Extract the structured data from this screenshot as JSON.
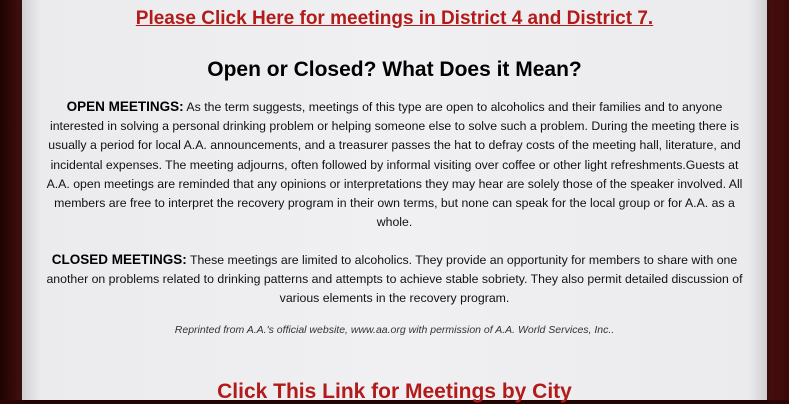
{
  "top_link": "Please Click Here for meetings in District 4 and District 7.",
  "heading": "Open or Closed? What Does it Mean?",
  "open_meetings": {
    "label": "OPEN MEETINGS:",
    "text": " As the term suggests, meetings of this type are open to alcoholics and their families and to anyone interested in solving a personal drinking problem or helping someone else to solve such a problem. During the meeting there is usually a period for local A.A. announcements, and a treasurer passes the hat to defray costs of the meeting hall, literature, and incidental expenses. The meeting adjourns, often followed by informal visiting over coffee or other light refreshments.Guests at A.A. open meetings are reminded that any opinions or interpretations they may hear are solely those of the speaker involved. All members are free to interpret the recovery program in their own terms, but none can speak for the local group or for A.A. as a whole."
  },
  "closed_meetings": {
    "label": "CLOSED MEETINGS:",
    "text": " These meetings are limited to alcoholics. They provide an opportunity for members to share with one another on problems related to drinking patterns and attempts to achieve stable sobriety. They also permit detailed discussion of various elements in the recovery program."
  },
  "credit": "Reprinted from A.A.'s official website, www.aa.org with permission of A.A. World Services, Inc..",
  "city_link": "Click This Link for Meetings by City",
  "colors": {
    "link_red": "#b31b1b",
    "frame_dark_red": "#2a0606",
    "panel_gray": "#f0f0f2"
  }
}
